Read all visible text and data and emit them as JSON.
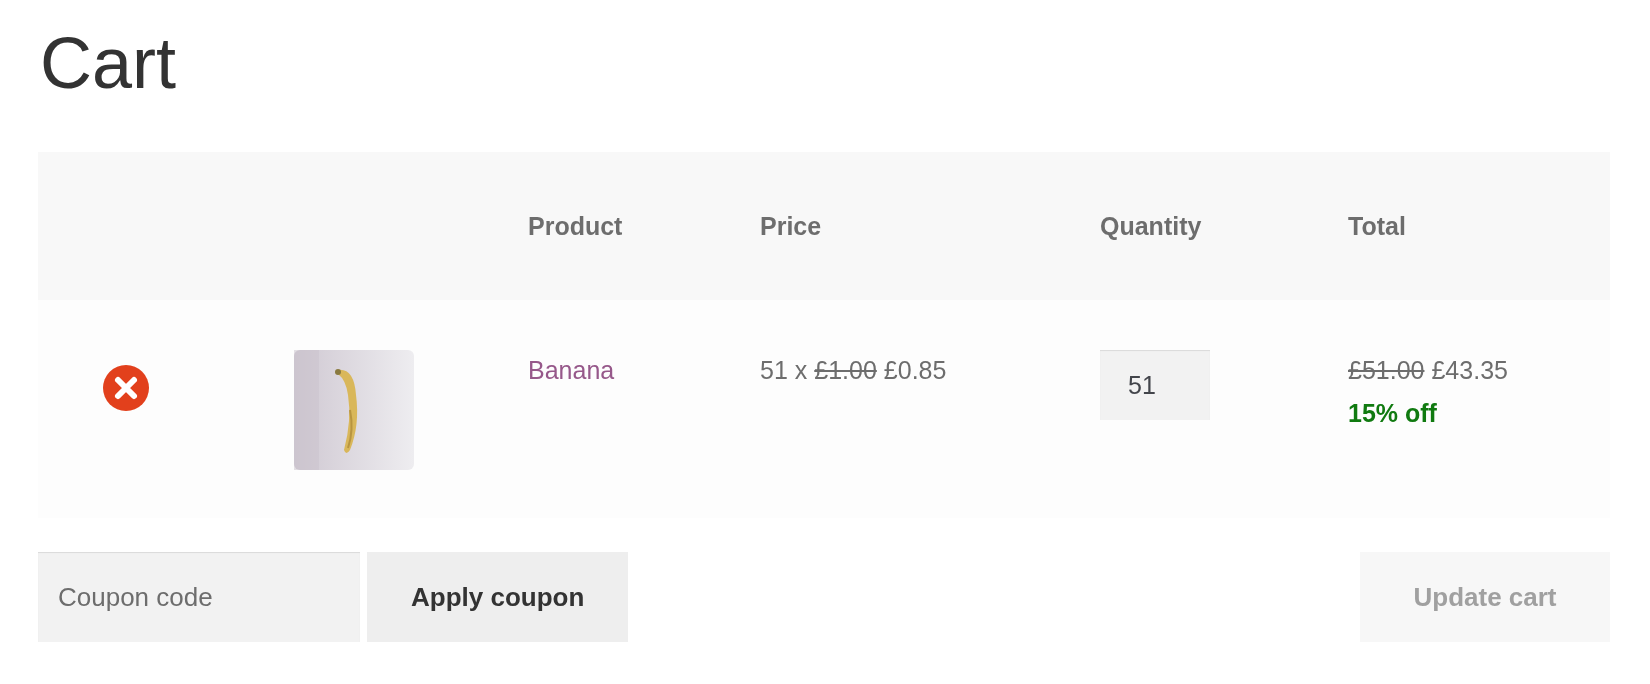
{
  "title": "Cart",
  "table": {
    "columns": [
      "",
      "",
      "Product",
      "Price",
      "Quantity",
      "Total"
    ],
    "rows": [
      {
        "product": "Banana",
        "price": {
          "prefix": "51 x",
          "regular": "£1.00",
          "sale": "£0.85"
        },
        "quantity": "51",
        "total": {
          "regular": "£51.00",
          "sale": "£43.35"
        },
        "discount": "15% off"
      }
    ]
  },
  "coupon": {
    "placeholder": "Coupon code"
  },
  "buttons": [
    {
      "label": "Apply coupon",
      "disabled": false
    },
    {
      "label": "Update cart",
      "disabled": true
    }
  ]
}
